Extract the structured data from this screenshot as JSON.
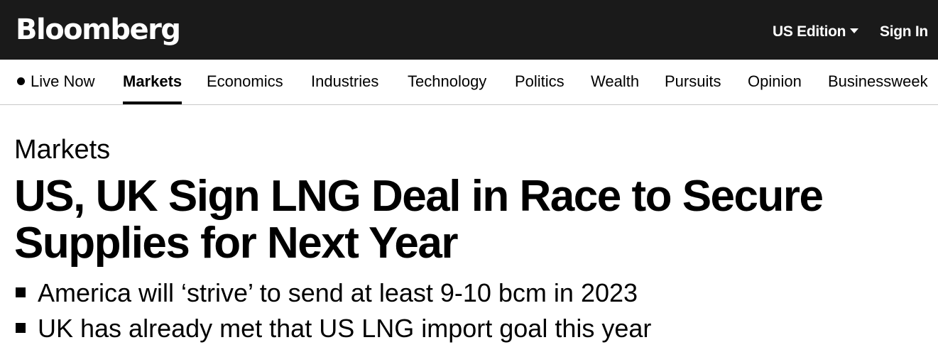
{
  "header": {
    "logo": "Bloomberg",
    "edition_label": "US Edition",
    "sign_in_label": "Sign In"
  },
  "nav": {
    "live_now_label": "Live Now",
    "items": [
      {
        "label": "Markets",
        "active": true
      },
      {
        "label": "Economics",
        "active": false
      },
      {
        "label": "Industries",
        "active": false
      },
      {
        "label": "Technology",
        "active": false
      },
      {
        "label": "Politics",
        "active": false
      },
      {
        "label": "Wealth",
        "active": false
      },
      {
        "label": "Pursuits",
        "active": false
      },
      {
        "label": "Opinion",
        "active": false
      },
      {
        "label": "Businessweek",
        "active": false
      }
    ]
  },
  "article": {
    "section": "Markets",
    "headline": "US, UK Sign LNG Deal in Race to Secure Supplies for Next Year",
    "bullets": [
      "America will ‘strive’ to send at least 9-10 bcm in 2023",
      "UK has already met that US LNG import goal this year"
    ]
  },
  "colors": {
    "header_bg": "#1a1a1a",
    "text": "#000000",
    "nav_divider": "#c8c8c8"
  }
}
